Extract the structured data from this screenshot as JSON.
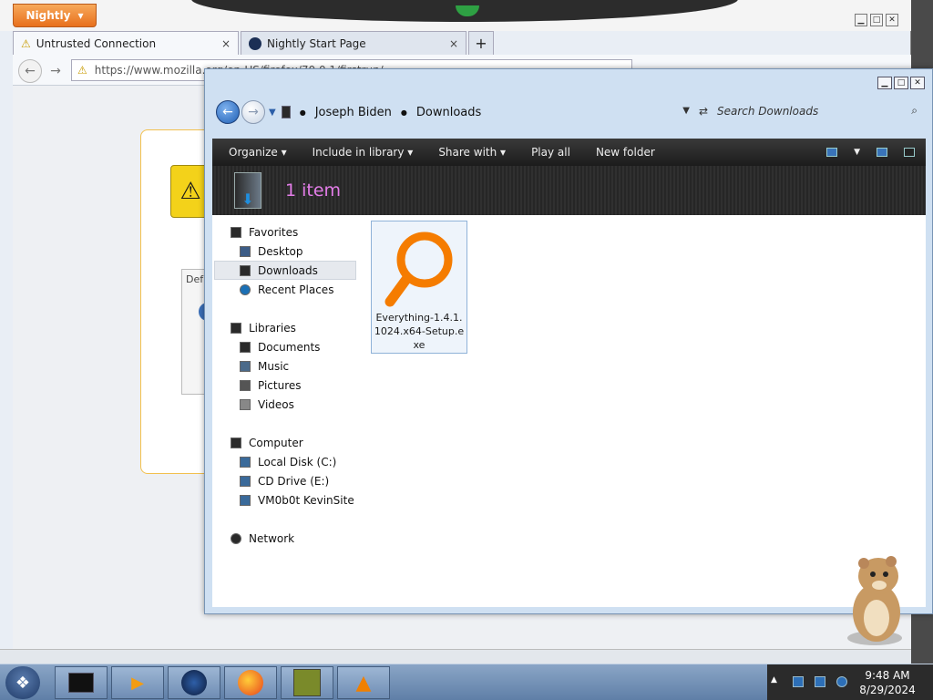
{
  "firefox": {
    "app_button": "Nightly",
    "tabs": [
      {
        "title": "Untrusted Connection",
        "close": "×"
      },
      {
        "title": "Nightly Start Page",
        "close": "×"
      }
    ],
    "new_tab": "+",
    "url": "https://www.mozilla.org/en-US/firefox/70.0.1/firstrun/",
    "inner_box_label": "Def"
  },
  "explorer": {
    "breadcrumb": [
      "Joseph Biden",
      "Downloads"
    ],
    "search_placeholder": "Search Downloads",
    "commands": [
      "Organize",
      "Include in library",
      "Share with",
      "Play all",
      "New folder"
    ],
    "item_count": "1 item",
    "nav": {
      "favorites": {
        "label": "Favorites",
        "items": [
          "Desktop",
          "Downloads",
          "Recent Places"
        ]
      },
      "libraries": {
        "label": "Libraries",
        "items": [
          "Documents",
          "Music",
          "Pictures",
          "Videos"
        ]
      },
      "computer": {
        "label": "Computer",
        "items": [
          "Local Disk (C:)",
          "CD Drive (E:)",
          "VM0b0t KevinSite"
        ]
      },
      "network": {
        "label": "Network"
      }
    },
    "selected_nav": "Downloads",
    "files": [
      {
        "name": "Everything-1.4.1.1024.x64-Setup.exe"
      }
    ]
  },
  "taskbar": {
    "time": "9:48 AM",
    "date": "8/29/2024"
  },
  "colors": {
    "item_count": "#e37de8",
    "nightly_orange": "#e8701c",
    "everything_icon": "#f57c00"
  }
}
